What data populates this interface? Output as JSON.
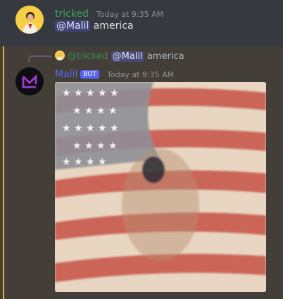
{
  "colors": {
    "background": "#36393f",
    "highlight": "#433f38",
    "highlight_bar": "#f0b232",
    "author_tricked": "#3ba55d",
    "author_malil": "#5865f2",
    "bot_tag": "#5865f2",
    "mention_bg": "#4a4f8c"
  },
  "messages": [
    {
      "author": "tricked",
      "timestamp": "Today at 9:35 AM",
      "mention": "@Malil",
      "text": " america",
      "avatar_icon": "user-avatar-icon"
    }
  ],
  "reply": {
    "author": "@tricked",
    "mention": "@Malil",
    "text": " america"
  },
  "bot_message": {
    "author": "Malil",
    "badge": "BOT",
    "timestamp": "Today at 9:35 AM",
    "avatar_icon": "malil-logo-icon",
    "attachment_icon": "american-flag-gif"
  }
}
